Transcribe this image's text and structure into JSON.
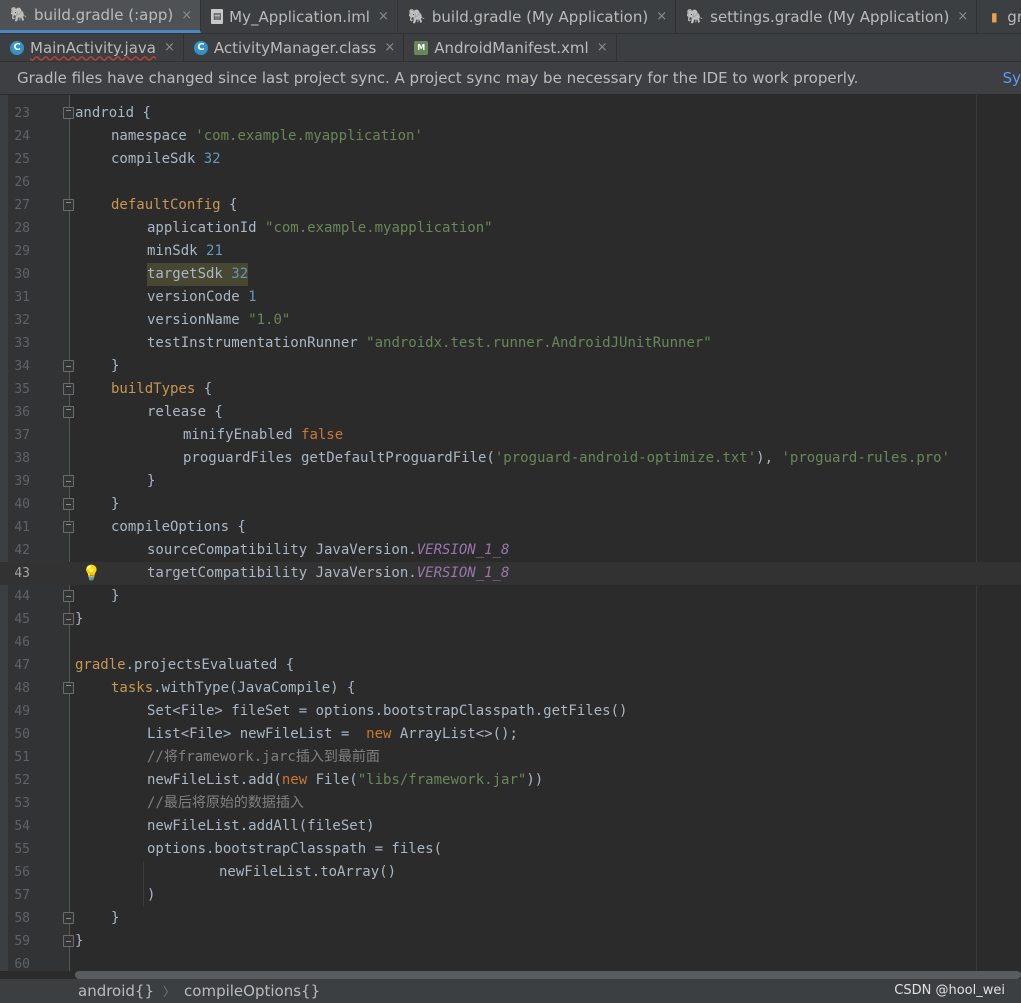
{
  "tabs_row1": [
    {
      "label": "build.gradle (:app)",
      "icon": "gradle-icon",
      "active": true
    },
    {
      "label": "My_Application.iml",
      "icon": "file-icon"
    },
    {
      "label": "build.gradle (My Application)",
      "icon": "gradle-icon"
    },
    {
      "label": "settings.gradle (My Application)",
      "icon": "gradle-icon"
    },
    {
      "label": "gradle.properties",
      "icon": "properties-icon"
    }
  ],
  "tabs_row2": [
    {
      "label": "MainActivity.java",
      "icon": "class-icon"
    },
    {
      "label": "ActivityManager.class",
      "icon": "class-icon"
    },
    {
      "label": "AndroidManifest.xml",
      "icon": "manifest-icon"
    }
  ],
  "close_glyph": "×",
  "banner": {
    "message": "Gradle files have changed since last project sync. A project sync may be necessary for the IDE to work properly.",
    "action": "Sy"
  },
  "gutter_numbers": [
    "23",
    "24",
    "25",
    "26",
    "27",
    "28",
    "29",
    "30",
    "31",
    "32",
    "33",
    "34",
    "35",
    "36",
    "37",
    "38",
    "39",
    "40",
    "41",
    "42",
    "43",
    "44",
    "45",
    "46",
    "47",
    "48",
    "49",
    "50",
    "51",
    "52",
    "53",
    "54",
    "55",
    "56",
    "57",
    "58",
    "59",
    "60"
  ],
  "code": {
    "l23": {
      "id": "android",
      "p": " {"
    },
    "l24": {
      "a": "namespace ",
      "s": "'com.example.myapplication'"
    },
    "l25": {
      "a": "compileSdk ",
      "n": "32"
    },
    "l27": {
      "id": "defaultConfig",
      "p": " {"
    },
    "l28": {
      "a": "applicationId ",
      "s": "\"com.example.myapplication\""
    },
    "l29": {
      "a": "minSdk ",
      "n": "21"
    },
    "l30": {
      "a": "targetSdk ",
      "n": "32"
    },
    "l31": {
      "a": "versionCode ",
      "n": "1"
    },
    "l32": {
      "a": "versionName ",
      "s": "\"1.0\""
    },
    "l33": {
      "a": "testInstrumentationRunner ",
      "s": "\"androidx.test.runner.AndroidJUnitRunner\""
    },
    "l34": {
      "p": "}"
    },
    "l35": {
      "id": "buildTypes",
      "p": " {"
    },
    "l36": {
      "a": "release {"
    },
    "l37": {
      "a": "minifyEnabled ",
      "k": "false"
    },
    "l38": {
      "a": "proguardFiles getDefaultProguardFile(",
      "s1": "'proguard-android-optimize.txt'",
      "m": "), ",
      "s2": "'proguard-rules.pro'"
    },
    "l39": {
      "p": "}"
    },
    "l40": {
      "p": "}"
    },
    "l41": {
      "a": "compileOptions {"
    },
    "l42": {
      "a": "sourceCompatibility JavaVersion.",
      "st": "VERSION_1_8"
    },
    "l43": {
      "a": "targetCompatibility JavaVersion.",
      "st": "VERSION_1_8"
    },
    "l44": {
      "p": "}"
    },
    "l45": {
      "p": "}"
    },
    "l47": {
      "id": "gradle",
      "a": ".projectsEvaluated {"
    },
    "l48": {
      "id": "tasks",
      "a": ".withType(JavaCompile) {"
    },
    "l49": {
      "a": "Set<File> fileSet = options.bootstrapClasspath.getFiles()"
    },
    "l50": {
      "a": "List<File> newFileList =  ",
      "k": "new",
      "b": " ArrayList<>();"
    },
    "l51": {
      "c": "//将framework.jarc插入到最前面"
    },
    "l52": {
      "a": "newFileList.add(",
      "k": "new",
      "b": " File(",
      "s": "\"libs/framework.jar\"",
      "e": "))"
    },
    "l53": {
      "c": "//最后将原始的数据插入"
    },
    "l54": {
      "a": "newFileList.addAll(fileSet)"
    },
    "l55": {
      "a": "options.bootstrapClasspath = files("
    },
    "l56": {
      "a": "newFileList.toArray()"
    },
    "l57": {
      "a": ")"
    },
    "l58": {
      "p": "}"
    },
    "l59": {
      "p": "}"
    }
  },
  "breadcrumbs": [
    "android{}",
    "compileOptions{}"
  ],
  "breadcrumb_sep": "〉",
  "watermark": "CSDN @hool_wei",
  "colors": {
    "keyword": "#cc7832",
    "string": "#6a8759",
    "number": "#6897bb",
    "static": "#9876aa",
    "comment": "#808080",
    "accent": "#4a88c7"
  }
}
